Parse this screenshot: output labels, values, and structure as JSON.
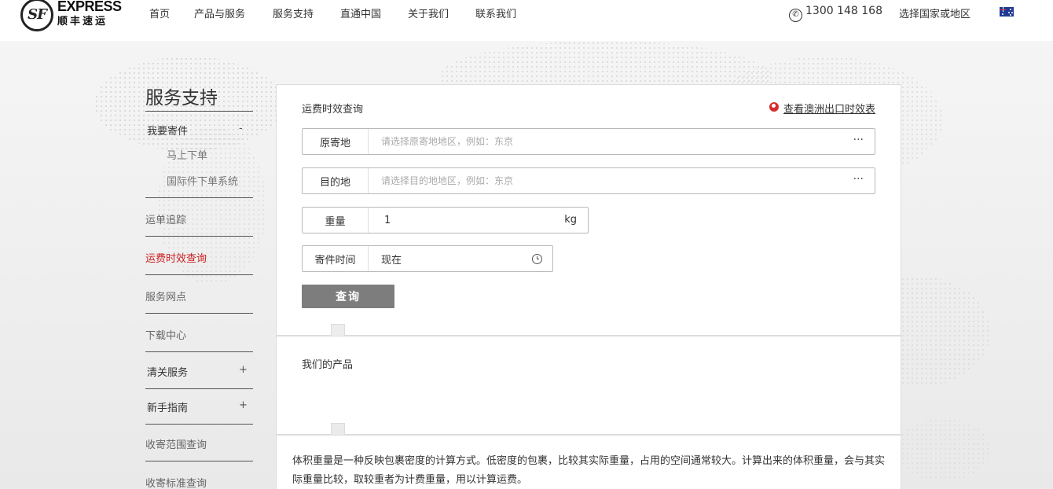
{
  "header": {
    "logo": {
      "mark": "SF",
      "en": "EXPRESS",
      "cn": "顺丰速运"
    },
    "nav": [
      "首页",
      "产品与服务",
      "服务支持",
      "直通中国",
      "关于我们",
      "联系我们"
    ],
    "phone": "1300 148 168",
    "country_select": "选择国家或地区",
    "flag_icon": "australia-flag-icon"
  },
  "sidebar": {
    "title": "服务支持",
    "send_group": {
      "label": "我要寄件",
      "toggle": "-",
      "children": [
        "马上下单",
        "国际件下单系统"
      ]
    },
    "items": {
      "tracking": "运单追踪",
      "rate_query": "运费时效查询",
      "service_points": "服务网点",
      "download": "下载中心",
      "customs": "清关服务",
      "guide": "新手指南",
      "coverage": "收寄范围查询",
      "standards": "收寄标准查询"
    },
    "toggles": {
      "customs": "+",
      "guide": "+"
    },
    "active_color": "#cc2020"
  },
  "rate_panel": {
    "title": "运费时效查询",
    "export_link": "查看澳洲出口时效表",
    "origin": {
      "label": "原寄地",
      "placeholder": "请选择原寄地地区，例如：东京",
      "more": "···"
    },
    "destination": {
      "label": "目的地",
      "placeholder": "请选择目的地地区，例如：东京",
      "more": "···"
    },
    "weight": {
      "label": "重量",
      "value": "1",
      "unit": "kg"
    },
    "send_time": {
      "label": "寄件时间",
      "value": "现在"
    },
    "query_button": "查询"
  },
  "products_panel": {
    "title": "我们的产品"
  },
  "info_panel": {
    "text": "体积重量是一种反映包裹密度的计算方式。低密度的包裹，比较其实际重量，占用的空间通常较大。计算出来的体积重量，会与其实际重量比较，取较重者为计费重量，用以计算运费。"
  }
}
